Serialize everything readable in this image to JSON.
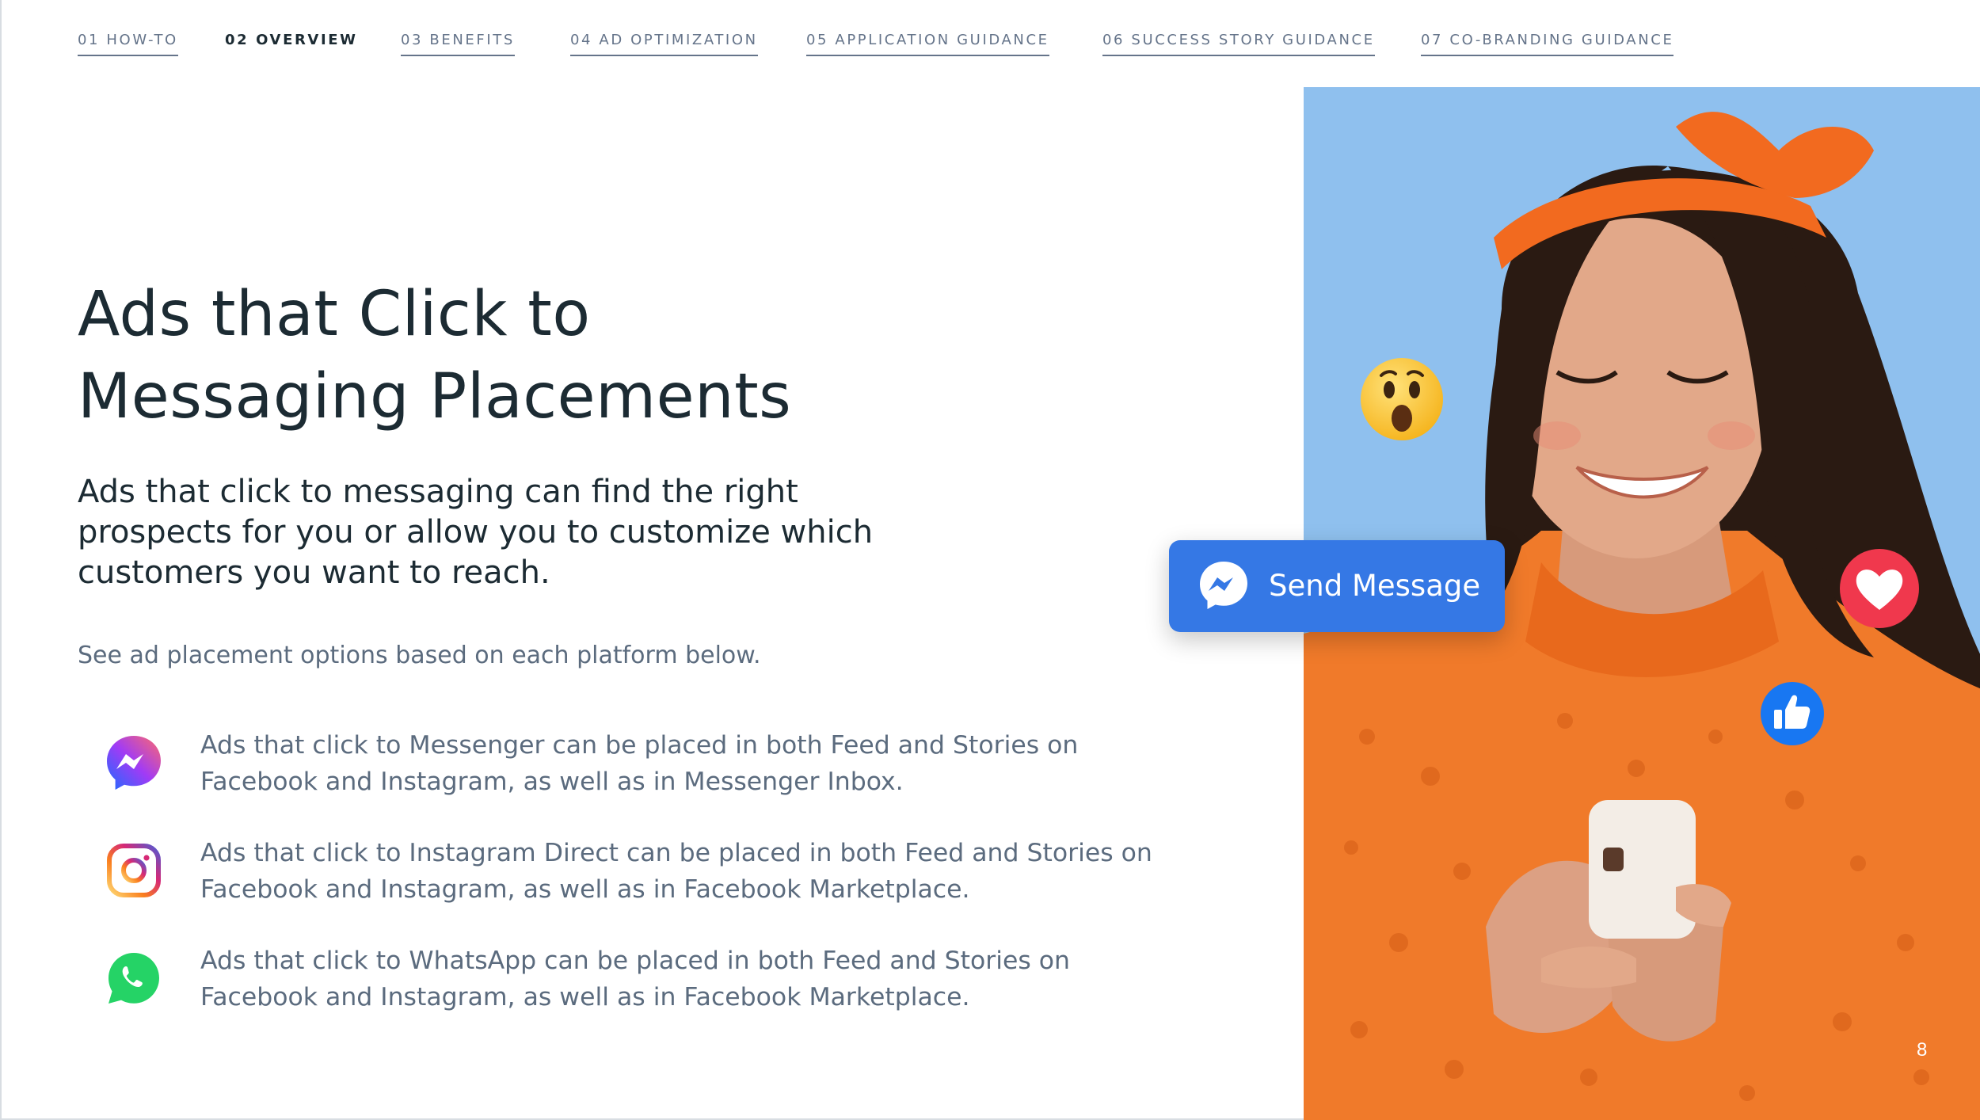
{
  "nav": [
    {
      "label": "01  HOW-TO",
      "active": false
    },
    {
      "label": "02  OVERVIEW",
      "active": true
    },
    {
      "label": "03  BENEFITS",
      "active": false
    },
    {
      "label": "04  AD OPTIMIZATION",
      "active": false
    },
    {
      "label": "05  APPLICATION GUIDANCE",
      "active": false
    },
    {
      "label": "06  SUCCESS STORY GUIDANCE",
      "active": false
    },
    {
      "label": "07  CO-BRANDING GUIDANCE",
      "active": false
    }
  ],
  "title": {
    "line1": "Ads that Click to",
    "line2": "Messaging Placements"
  },
  "lede": "Ads that click to messaging can find the right prospects for you or allow you to customize which customers you want to reach.",
  "note": "See ad placement options based on each platform below.",
  "placements": [
    {
      "icon": "messenger-icon",
      "text": "Ads that click to Messenger can be placed in both Feed and Stories on Facebook and Instagram, as well as in Messenger Inbox."
    },
    {
      "icon": "instagram-icon",
      "text": "Ads that click to Instagram Direct can be placed in both Feed and Stories on Facebook and Instagram, as well as in Facebook Marketplace."
    },
    {
      "icon": "whatsapp-icon",
      "text": "Ads that click to WhatsApp can be placed in both Feed and Stories on Facebook and Instagram, as well as in Facebook Marketplace."
    }
  ],
  "cta": {
    "label": "Send Message",
    "icon": "messenger-icon"
  },
  "reactions": [
    "wow-emoji-icon",
    "love-reaction-icon",
    "like-reaction-icon"
  ],
  "page_number": "8",
  "colors": {
    "text_dark": "#1c2b33",
    "text_muted": "#5b6b7e",
    "cta_blue": "#3578e5",
    "photo_bg": "#8fc0ee",
    "sweater_orange": "#f07a2a"
  }
}
